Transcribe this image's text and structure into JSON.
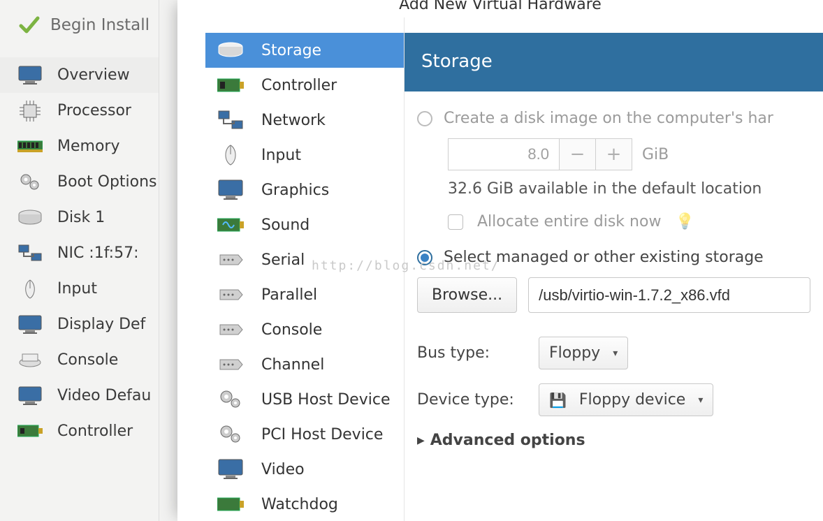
{
  "back_window": {
    "begin_install": "Begin Install",
    "items": [
      {
        "label": "Overview"
      },
      {
        "label": "Processor"
      },
      {
        "label": "Memory"
      },
      {
        "label": "Boot Options"
      },
      {
        "label": "Disk 1"
      },
      {
        "label": "NIC :1f:57:"
      },
      {
        "label": "Input"
      },
      {
        "label": "Display Def"
      },
      {
        "label": "Console"
      },
      {
        "label": "Video Defau"
      },
      {
        "label": "Controller"
      }
    ]
  },
  "modal": {
    "title": "Add New Virtual Hardware",
    "categories": [
      {
        "label": "Storage"
      },
      {
        "label": "Controller"
      },
      {
        "label": "Network"
      },
      {
        "label": "Input"
      },
      {
        "label": "Graphics"
      },
      {
        "label": "Sound"
      },
      {
        "label": "Serial"
      },
      {
        "label": "Parallel"
      },
      {
        "label": "Console"
      },
      {
        "label": "Channel"
      },
      {
        "label": "USB Host Device"
      },
      {
        "label": "PCI Host Device"
      },
      {
        "label": "Video"
      },
      {
        "label": "Watchdog"
      }
    ],
    "panel_header": "Storage",
    "radio_create": "Create a disk image on the computer's har",
    "disk_size": "8.0",
    "disk_unit": "GiB",
    "avail": "32.6 GiB available in the default location",
    "allocate": "Allocate entire disk now",
    "radio_existing": "Select managed or other existing storage",
    "browse": "Browse...",
    "path": "/usb/virtio-win-1.7.2_x86.vfd",
    "bus_label": "Bus type:",
    "bus_value": "Floppy",
    "dev_label": "Device type:",
    "dev_value": "Floppy device",
    "advanced": "Advanced options"
  },
  "watermark": "http://blog.csdn.net/"
}
